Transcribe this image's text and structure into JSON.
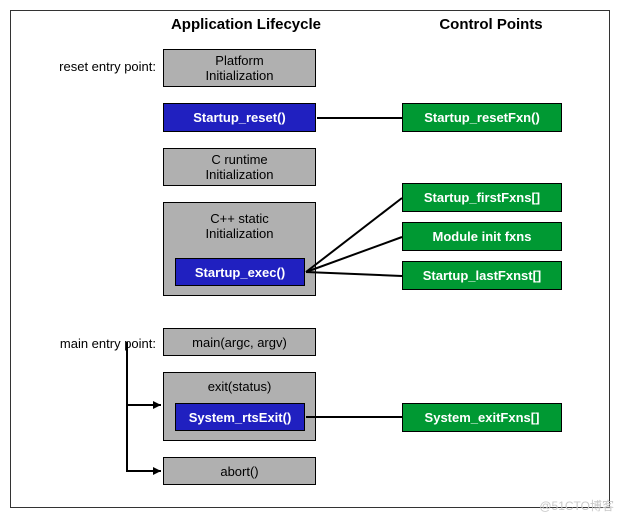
{
  "headers": {
    "left": "Application Lifecycle",
    "right": "Control Points"
  },
  "side_labels": {
    "reset": "reset entry point:",
    "main": "main entry point:"
  },
  "lifecycle": {
    "platform_init": "Platform\nInitialization",
    "startup_reset": "Startup_reset()",
    "c_runtime": "C runtime\nInitialization",
    "cpp_static": "C++ static\nInitialization",
    "startup_exec": "Startup_exec()",
    "main": "main(argc, argv)",
    "exit": "exit(status)",
    "system_rtsExit": "System_rtsExit()",
    "abort": "abort()"
  },
  "controls": {
    "resetFxn": "Startup_resetFxn()",
    "firstFxns": "Startup_firstFxns[]",
    "moduleInit": "Module init fxns",
    "lastFxnst": "Startup_lastFxnst[]",
    "exitFxns": "System_exitFxns[]"
  },
  "watermark": "@51CTO博客"
}
